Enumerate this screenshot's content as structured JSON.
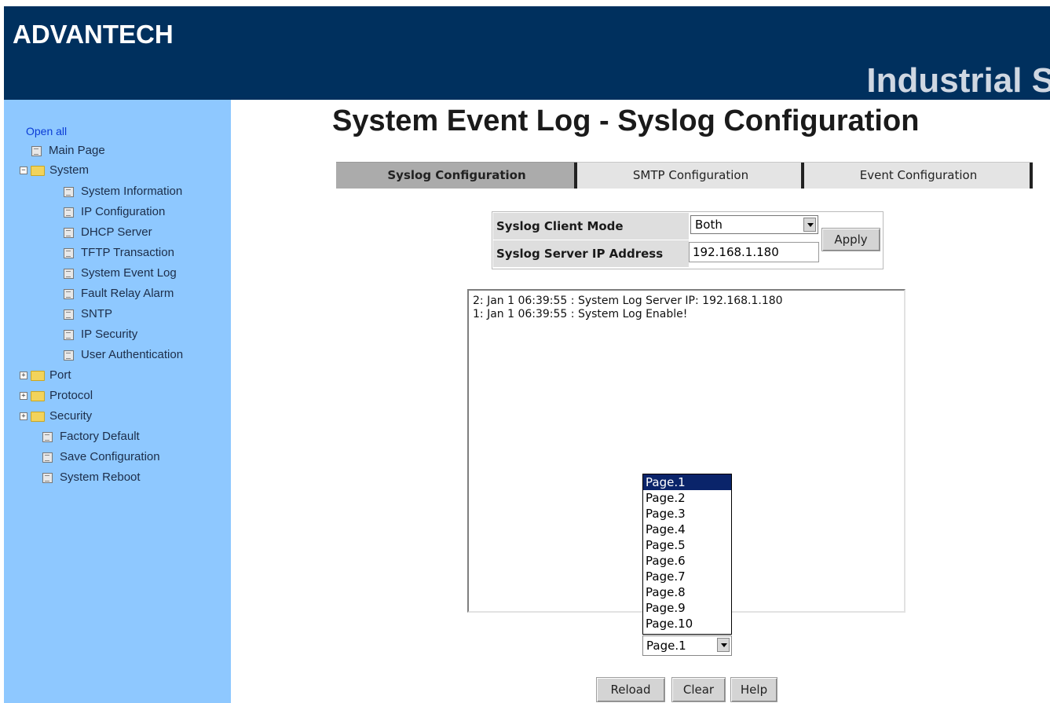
{
  "header": {
    "logo": "ADVANTECH",
    "brand": "Industrial S"
  },
  "sidebar": {
    "open_all": "Open all",
    "items": [
      {
        "label": "Main Page",
        "type": "doc"
      },
      {
        "label": "System",
        "type": "folder-open"
      },
      {
        "label": "System Information",
        "type": "doc"
      },
      {
        "label": "IP Configuration",
        "type": "doc"
      },
      {
        "label": "DHCP Server",
        "type": "doc"
      },
      {
        "label": "TFTP Transaction",
        "type": "doc"
      },
      {
        "label": "System Event Log",
        "type": "doc"
      },
      {
        "label": "Fault Relay Alarm",
        "type": "doc"
      },
      {
        "label": "SNTP",
        "type": "doc"
      },
      {
        "label": "IP Security",
        "type": "doc"
      },
      {
        "label": "User Authentication",
        "type": "doc"
      },
      {
        "label": "Port",
        "type": "folder"
      },
      {
        "label": "Protocol",
        "type": "folder"
      },
      {
        "label": "Security",
        "type": "folder"
      },
      {
        "label": "Factory Default",
        "type": "doc"
      },
      {
        "label": "Save Configuration",
        "type": "doc"
      },
      {
        "label": "System Reboot",
        "type": "doc"
      }
    ]
  },
  "main": {
    "title": "System Event Log - Syslog Configuration",
    "tabs": [
      {
        "label": "Syslog Configuration",
        "active": true
      },
      {
        "label": "SMTP Configuration",
        "active": false
      },
      {
        "label": "Event Configuration",
        "active": false
      }
    ],
    "config": {
      "mode_label": "Syslog Client Mode",
      "mode_value": "Both",
      "ip_label": "Syslog Server IP Address",
      "ip_value": "192.168.1.180",
      "apply_label": "Apply"
    },
    "log_lines": [
      "2: Jan 1 06:39:55 : System Log Server IP: 192.168.1.180",
      "1: Jan 1 06:39:55 : System Log Enable!"
    ],
    "pages": [
      "Page.1",
      "Page.2",
      "Page.3",
      "Page.4",
      "Page.5",
      "Page.6",
      "Page.7",
      "Page.8",
      "Page.9",
      "Page.10"
    ],
    "selected_page": "Page.1",
    "buttons": {
      "reload": "Reload",
      "clear": "Clear",
      "help": "Help"
    }
  }
}
